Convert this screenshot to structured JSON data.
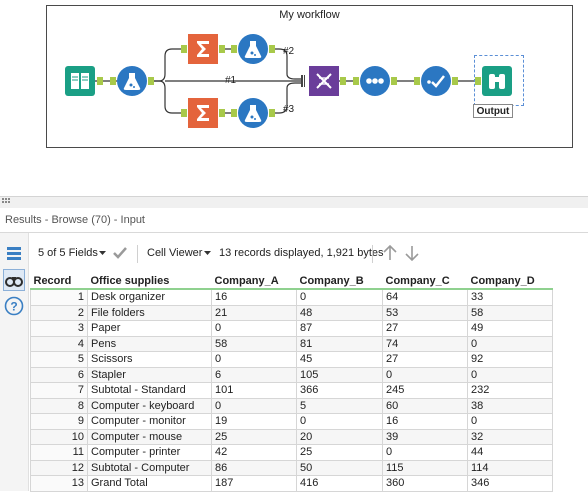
{
  "workflow": {
    "title": "My workflow",
    "wire_labels": [
      "#2",
      "#1",
      "#3"
    ],
    "output_label": "Output",
    "colors": {
      "input": "#1a9f85",
      "formula": "#2b77c2",
      "summarize": "#e4643c",
      "union": "#6a3d9a",
      "select": "#2b77c2",
      "connector": "#a8c94a"
    },
    "tools": [
      "input-book-icon",
      "formula-flask-icon",
      "summarize-sigma-icon",
      "summarize-sigma-icon",
      "formula-flask-icon",
      "formula-flask-icon",
      "union-dna-icon",
      "select-dots-icon",
      "clean-check-icon",
      "browse-binoculars-icon"
    ]
  },
  "results": {
    "title": "Results - Browse (70) - Input",
    "fields_selector": "5 of 5 Fields",
    "cell_viewer": "Cell Viewer",
    "records_info": "13 records displayed, 1,921 bytes"
  },
  "table": {
    "columns": [
      "Record",
      "Office supplies",
      "Company_A",
      "Company_B",
      "Company_C",
      "Company_D"
    ],
    "rows": [
      [
        "1",
        "Desk organizer",
        "16",
        "0",
        "64",
        "33"
      ],
      [
        "2",
        "File folders",
        "21",
        "48",
        "53",
        "58"
      ],
      [
        "3",
        "Paper",
        "0",
        "87",
        "27",
        "49"
      ],
      [
        "4",
        "Pens",
        "58",
        "81",
        "74",
        "0"
      ],
      [
        "5",
        "Scissors",
        "0",
        "45",
        "27",
        "92"
      ],
      [
        "6",
        "Stapler",
        "6",
        "105",
        "0",
        "0"
      ],
      [
        "7",
        "Subtotal - Standard",
        "101",
        "366",
        "245",
        "232"
      ],
      [
        "8",
        "Computer - keyboard",
        "0",
        "5",
        "60",
        "38"
      ],
      [
        "9",
        "Computer - monitor",
        "19",
        "0",
        "16",
        "0"
      ],
      [
        "10",
        "Computer - mouse",
        "25",
        "20",
        "39",
        "32"
      ],
      [
        "11",
        "Computer - printer",
        "42",
        "25",
        "0",
        "44"
      ],
      [
        "12",
        "Subtotal - Computer",
        "86",
        "50",
        "115",
        "114"
      ],
      [
        "13",
        "Grand Total",
        "187",
        "416",
        "360",
        "346"
      ]
    ]
  }
}
